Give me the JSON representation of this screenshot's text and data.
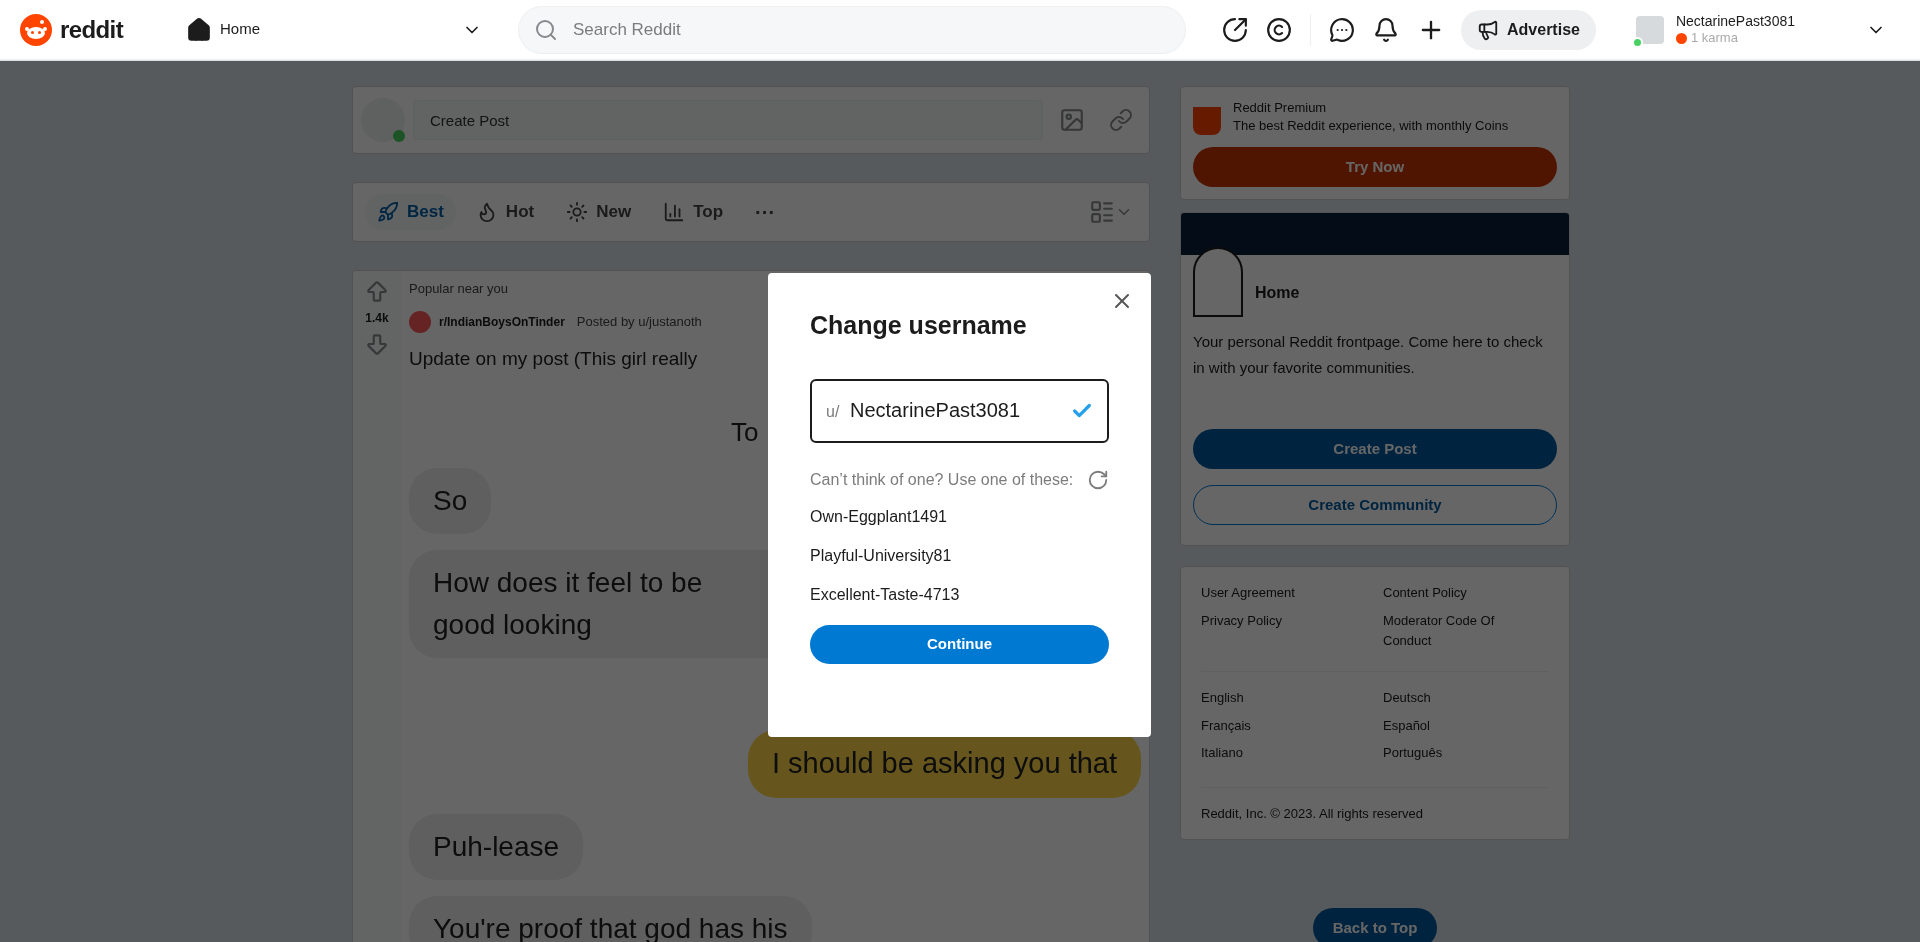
{
  "header": {
    "logo": "reddit",
    "feed": "Home",
    "search": {
      "placeholder": "Search Reddit"
    },
    "advertise": "Advertise",
    "user": {
      "name": "NectarinePast3081",
      "karma": "1 karma",
      "online": true
    }
  },
  "create_post": {
    "placeholder": "Create Post"
  },
  "sort_tabs": [
    {
      "kind": "best",
      "label": "Best",
      "selected": true
    },
    {
      "kind": "hot",
      "label": "Hot",
      "selected": false
    },
    {
      "kind": "new",
      "label": "New",
      "selected": false
    },
    {
      "kind": "top",
      "label": "Top",
      "selected": false
    }
  ],
  "more": "···",
  "post": {
    "context": "Popular near you",
    "votes": "1.4k",
    "subreddit": "r/IndianBoysOnTinder",
    "posted_by": "Posted by u/justanoth",
    "title": "Update on my post (This girl really",
    "image_header": "To",
    "messages": [
      {
        "kind": "received",
        "lines": [
          "So"
        ]
      },
      {
        "kind": "received",
        "lines": [
          "How does it feel to be",
          "good looking"
        ]
      },
      {
        "kind": "sent",
        "lines": [
          "I should be asking you that"
        ]
      },
      {
        "kind": "received",
        "lines": [
          "Puh-lease"
        ]
      },
      {
        "kind": "received",
        "lines": [
          "You're proof that god has his"
        ]
      }
    ]
  },
  "sidebar": {
    "premium": {
      "title": "Reddit Premium",
      "text": "The best Reddit experience, with monthly Coins",
      "button": "Try Now"
    },
    "home": {
      "title": "Home",
      "text": "Your personal Reddit frontpage. Come here to check in with your favorite communities.",
      "primary_button": "Create Post",
      "secondary_button": "Create Community"
    },
    "links": [
      "User Agreement",
      "Content Policy",
      "Privacy Policy",
      "Moderator Code Of Conduct"
    ],
    "languages": [
      "English",
      "Deutsch",
      "Français",
      "Español",
      "Italiano",
      "Português"
    ],
    "copyright": "Reddit, Inc. © 2023. All rights reserved"
  },
  "back_to_top": "Back to Top",
  "modal": {
    "title": "Change username",
    "prefix": "u/",
    "value": "NectarinePast3081",
    "valid": true,
    "hint": "Can’t think of one? Use one of these:",
    "suggestions": [
      "Own-Eggplant1491",
      "Playful-University81",
      "Excellent-Taste-4713"
    ],
    "button": "Continue"
  }
}
